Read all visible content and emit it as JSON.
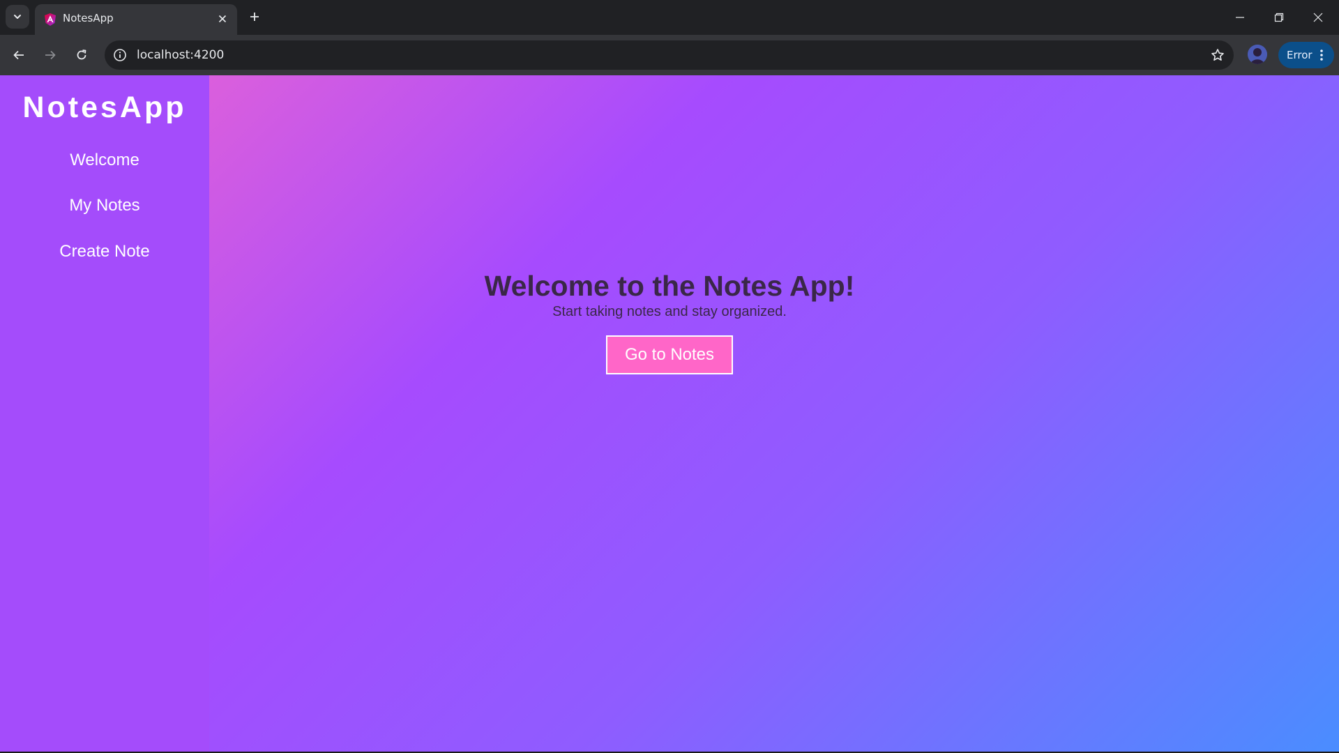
{
  "browser": {
    "tab": {
      "title": "NotesApp"
    },
    "address_bar": {
      "url": "localhost:4200"
    },
    "profile_badge": {
      "label": "Error"
    }
  },
  "app": {
    "brand": "NotesApp",
    "nav": [
      {
        "label": "Welcome"
      },
      {
        "label": "My Notes"
      },
      {
        "label": "Create Note"
      }
    ],
    "hero": {
      "title": "Welcome to the Notes App!",
      "subtitle": "Start taking notes and stay organized.",
      "cta_label": "Go to Notes"
    }
  },
  "colors": {
    "sidebar": "#a44cfb",
    "cta": "#ff66c8",
    "text_dark": "#3a2748"
  }
}
